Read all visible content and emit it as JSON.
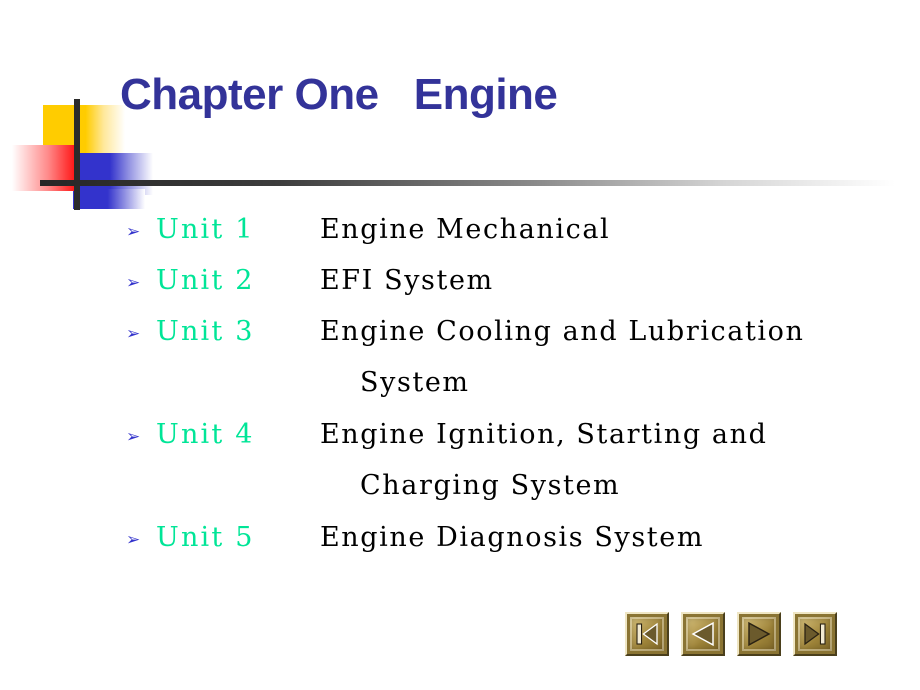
{
  "slide": {
    "title": "Chapter One   Engine",
    "background_color": "#FFFFFF",
    "title_color": "#333399",
    "unit_label_color": "#00E597",
    "description_color": "#000000",
    "bullet_marker_color": "#3333CC",
    "bullet_marker_glyph": "➢"
  },
  "decoration": {
    "yellow_color": "#FFCC00",
    "red_color": "#FF1A1A",
    "blue_color": "#3333CC",
    "bar_color": "#2B2B2B",
    "rule_color": "#262626"
  },
  "bullets": [
    {
      "marker": "➢",
      "unit": "Unit 1",
      "description": "Engine Mechanical",
      "continuation": ""
    },
    {
      "marker": "➢",
      "unit": "Unit 2",
      "description": "EFI System",
      "continuation": ""
    },
    {
      "marker": "➢",
      "unit": "Unit 3",
      "description": "Engine Cooling and Lubrication",
      "continuation": "System"
    },
    {
      "marker": "➢",
      "unit": "Unit 4",
      "description": "Engine Ignition, Starting and",
      "continuation": "Charging System"
    },
    {
      "marker": "➢",
      "unit": "Unit 5",
      "description": "Engine Diagnosis System",
      "continuation": ""
    }
  ],
  "navigation": {
    "buttons": [
      {
        "name": "first-slide-button",
        "icon": "skip-to-start-icon",
        "label": "First"
      },
      {
        "name": "previous-slide-button",
        "icon": "previous-icon",
        "label": "Previous"
      },
      {
        "name": "next-slide-button",
        "icon": "next-icon",
        "label": "Next"
      },
      {
        "name": "last-slide-button",
        "icon": "skip-to-end-icon",
        "label": "Last"
      }
    ]
  }
}
